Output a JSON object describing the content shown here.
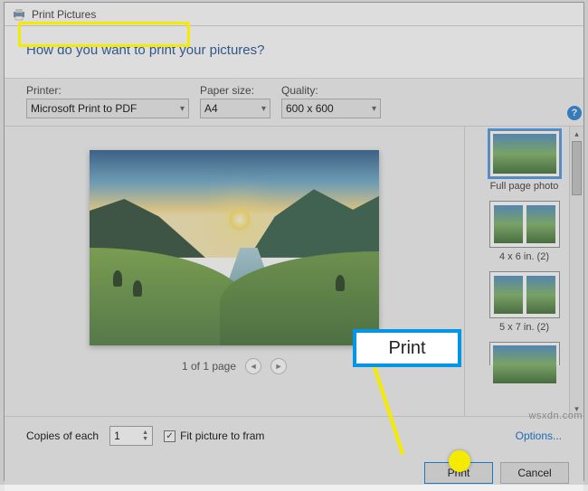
{
  "titlebar": {
    "title": "Print Pictures"
  },
  "header": {
    "question": "How do you want to print your pictures?"
  },
  "controls": {
    "printer_label": "Printer:",
    "printer_value": "Microsoft Print to PDF",
    "paper_label": "Paper size:",
    "paper_value": "A4",
    "quality_label": "Quality:",
    "quality_value": "600 x 600"
  },
  "help_icon_glyph": "?",
  "pager": {
    "text": "1 of 1 page"
  },
  "layouts": {
    "items": [
      {
        "label": "Full page photo"
      },
      {
        "label": "4 x 6 in. (2)"
      },
      {
        "label": "5 x 7 in. (2)"
      },
      {
        "label": ""
      }
    ]
  },
  "bottom": {
    "copies_label": "Copies of each",
    "copies_value": "1",
    "fit_checked": true,
    "fit_label": "Fit picture to fram",
    "options_link": "Options..."
  },
  "footer": {
    "print_label": "Print",
    "cancel_label": "Cancel"
  },
  "annotation": {
    "print_callout": "Print"
  },
  "watermark": "wsxdn.com"
}
